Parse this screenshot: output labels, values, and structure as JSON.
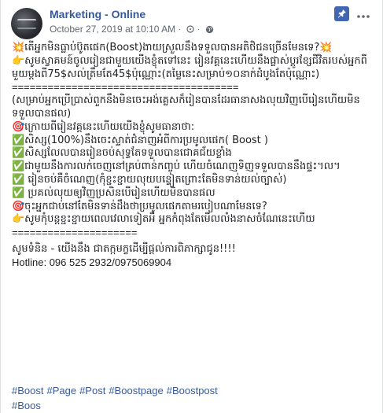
{
  "post": {
    "page_name": "Marketing - Online",
    "timestamp": "October 27, 2019 at 10:10 AM",
    "separator": "·",
    "icons": {
      "pin": "pin-icon",
      "more": "more-options-icon",
      "clock": "schedule-icon",
      "globe": "public-globe-icon"
    }
  },
  "content": {
    "lines": [
      "💥តើអ្នកមិនធ្លាប់ប៊ូតផេក(Boost)ងាយស្រួលនឹងទទួលបានអតិថិជនច្រើនមែនទេ?💥",
      "👉សូមស្វាគមន៍ចូលរៀនជាមួយយើងខ្ញុំតទៅនេះ រៀនវគ្គនេះហើយនឹងផ្លាស់ប្តូរខ្សែជីវិតរបស់អ្នកពីមួយម្តងពី75$សល់ត្រឹមតែ45$ប៉ុណ្ណោះ(តម្លៃនេះសម្រាប់១០នាក់ដំបូងតែប៉ុណ្ណោះ)",
      "======================================",
      "(សម្រាប់អ្នកប្រើប្រាស់ពួកនឹងមិនចេះអង់គ្លេសក៏រៀនបានដែរធានាសងលុយវិញបើរៀនហើយមិនទទួលបានផល)",
      "🎯ក្រោយពីរៀនវគ្គនេះហើយយើងខ្ញុំសូមធានាថា:",
      "✅សិស្ស(100%)នឹងចេះស្ទាត់ជំនាញអំពីការប្រមូលផេក( Boost )",
      "✅សិស្សលែលបានរៀនចប់សុទ្ធតែទទួលបានជោគជ័យខ្លាំង",
      "✅ជាមួយនឹងការលក់ចេញនៅគ្រប់ពាន់កញ្ចប់ ហើយចំណេញទិញទទួលបាននឹងផ្ទះ។ល។",
      "✅ រៀនចប់គឺចំណេញ(កុំខ្ជះខ្ជាយលុយបន្ទៀតព្រោះតែមិនទាន់យល់ច្បាស់)",
      "✅ ប្រគល់លុយឲ្យវិញប្រសិនបើរៀនហើយមិនបានផល",
      "🎯ចុះអ្នកជាប់នៅតែមិនទាន់ដឹងថាប្រមូលផេកតាមរបៀបណាមែនទេ?",
      "👉សូមកុំបន្តខ្ជះខ្ជាយពេលវេលាទៀតអី អ្នកកំពុងតែមើលលំងនាសចំណែនេះហើយ",
      "=====================",
      "សូមទំនិន - យើងនឹង ជាតក្កមក្ខដើម្បីផ្តល់ការពិភាក្សាជូន!!!!",
      "Hotline: 096 525 2932/0975069904"
    ],
    "hashtags": [
      "#Boost",
      "#Page",
      "#Post",
      "#Boostpage",
      "#Boostpost",
      "#Boos"
    ]
  }
}
